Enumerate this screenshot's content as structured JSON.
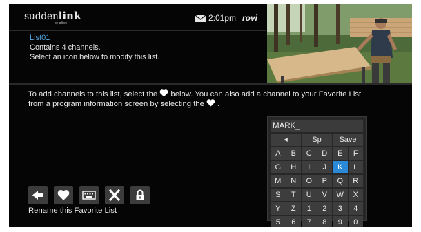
{
  "header": {
    "brand_main": "sudden",
    "brand_bold": "link",
    "brand_sub": "by altice",
    "time": "2:01pm",
    "guide_brand": "rovi"
  },
  "info": {
    "list_name": "List01",
    "channel_count": "Contains 4 channels.",
    "instruction": "Select an icon below to modify this list."
  },
  "instructions": {
    "line1_a": "To add channels to this list, select the",
    "line1_b": "below. You can also add a channel to your Favorite List",
    "line2_a": "from a program information screen by selecting the",
    "line2_b": "."
  },
  "actions": {
    "icons": [
      "left-arrow-icon",
      "heart-icon",
      "keyboard-icon",
      "close-icon",
      "lock-icon"
    ],
    "focused_label": "Rename this Favorite List"
  },
  "keyboard": {
    "input_value": "MARK_",
    "back_key": "◂",
    "space_key": "Sp",
    "save_key": "Save",
    "rows": [
      [
        "A",
        "B",
        "C",
        "D",
        "E",
        "F"
      ],
      [
        "G",
        "H",
        "I",
        "J",
        "K",
        "L"
      ],
      [
        "M",
        "N",
        "O",
        "P",
        "Q",
        "R"
      ],
      [
        "S",
        "T",
        "U",
        "V",
        "W",
        "X"
      ],
      [
        "Y",
        "Z",
        "1",
        "2",
        "3",
        "4"
      ],
      [
        "5",
        "6",
        "7",
        "8",
        "9",
        "0"
      ]
    ],
    "selected_key": "K"
  },
  "colors": {
    "screen_bg": "#050505",
    "list_name": "#55a8e6",
    "selected_key": "#2a8ad8",
    "button_bg": "#3c3c3c"
  }
}
